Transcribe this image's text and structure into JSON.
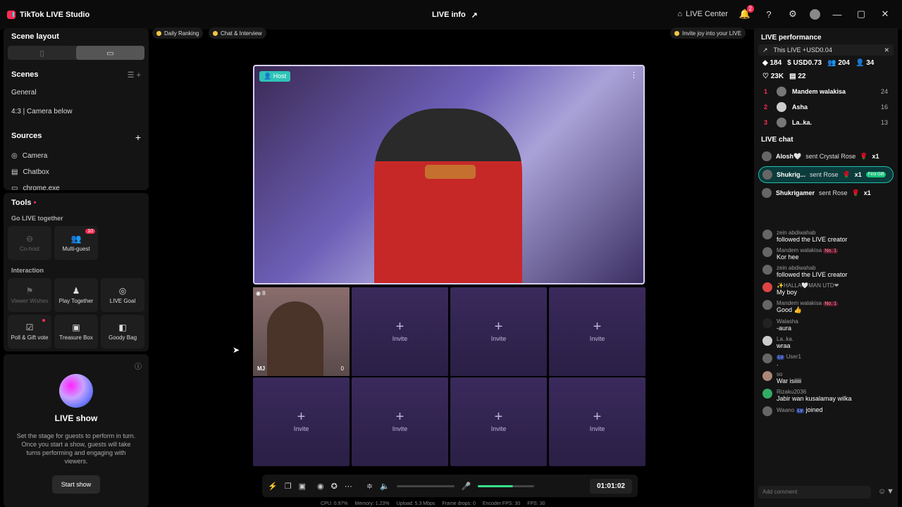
{
  "app": {
    "title": "TikTok LIVE Studio"
  },
  "header": {
    "live_info": "LIVE info",
    "live_center": "LIVE Center",
    "notif_count": "2"
  },
  "left": {
    "scene_layout": "Scene layout",
    "scenes_title": "Scenes",
    "scenes": [
      "General",
      "4:3 | Camera below"
    ],
    "sources_title": "Sources",
    "sources": [
      "Camera",
      "Chatbox",
      "chrome.exe"
    ],
    "tools_title": "Tools",
    "go_live": "Go LIVE together",
    "cohost": "Co-host",
    "multiguest": "Multi-guest",
    "multiguest_count": "10",
    "interaction": "Interaction",
    "viewer_wishes": "Viewer Wishes",
    "play_together": "Play Together",
    "live_goal": "LIVE Goal",
    "poll": "Poll & Gift vote",
    "treasure": "Treasure Box",
    "goody": "Goody Bag"
  },
  "show": {
    "title": "LIVE show",
    "desc": "Set the stage for guests to perform in turn. Once you start a show, guests will take turns performing and engaging with viewers.",
    "start": "Start show"
  },
  "top": {
    "daily": "Daily Ranking",
    "chat": "Chat & Interview",
    "invite": "Invite joy into your LIVE"
  },
  "stage": {
    "host": "Host",
    "guest_initials": "MJ",
    "guest_count": "8",
    "guest_score": "0",
    "invite": "Invite"
  },
  "controls": {
    "timer": "01:01:02",
    "volume_level": 0.62
  },
  "stats": {
    "cpu": "CPU: 0.97%",
    "memory": "Memory: 1.23%",
    "upload": "Upload: 5.3 Mbps",
    "drops": "Frame drops: 0",
    "encoder": "Encoder FPS: 30",
    "fps": "FPS: 30"
  },
  "perf": {
    "title": "LIVE performance",
    "income": "This LIVE +USD0.04",
    "m1": "184",
    "m2": "USD0.73",
    "m3": "204",
    "m4": "34",
    "m5": "23K",
    "m6": "22",
    "ranking": [
      {
        "n": "1",
        "name": "Mandem walakisa",
        "v": "24"
      },
      {
        "n": "2",
        "name": "Asha",
        "v": "16"
      },
      {
        "n": "3",
        "name": "La..ka.",
        "v": "13"
      }
    ]
  },
  "chat": {
    "title": "LIVE chat",
    "gifts": [
      {
        "name": "Alosh🤍",
        "text": "sent Crystal Rose",
        "count": "x1"
      },
      {
        "name": "Shukrig...",
        "text": "sent Rose",
        "count": "x1",
        "badge": "First Gift"
      },
      {
        "name": "Shukrigamer",
        "text": "sent Rose",
        "count": "x1"
      }
    ],
    "messages": [
      {
        "name": "zein abdiwahab",
        "text": "followed the LIVE creator"
      },
      {
        "name": "Mandem walakisa",
        "tag": "No. 1",
        "text": "Kor hee"
      },
      {
        "name": "zein abdiwahab",
        "text": "followed the LIVE creator"
      },
      {
        "name": "✨HALLA🤍MAN UTD❤",
        "text": "My boy"
      },
      {
        "name": "Mandem walakisa",
        "tag": "No. 1",
        "text": "Good 👍"
      },
      {
        "name": "Walasha",
        "text": "-aura"
      },
      {
        "name": "La..ka.",
        "text": "wraa"
      },
      {
        "name": "User1",
        "text": "."
      },
      {
        "name": "so",
        "text": "War isiiiii"
      },
      {
        "name": "Rizaku2036",
        "text": "Jabir wan kusalamay wilka"
      },
      {
        "name": "Waano",
        "text": "joined"
      }
    ],
    "placeholder": "Add comment"
  }
}
